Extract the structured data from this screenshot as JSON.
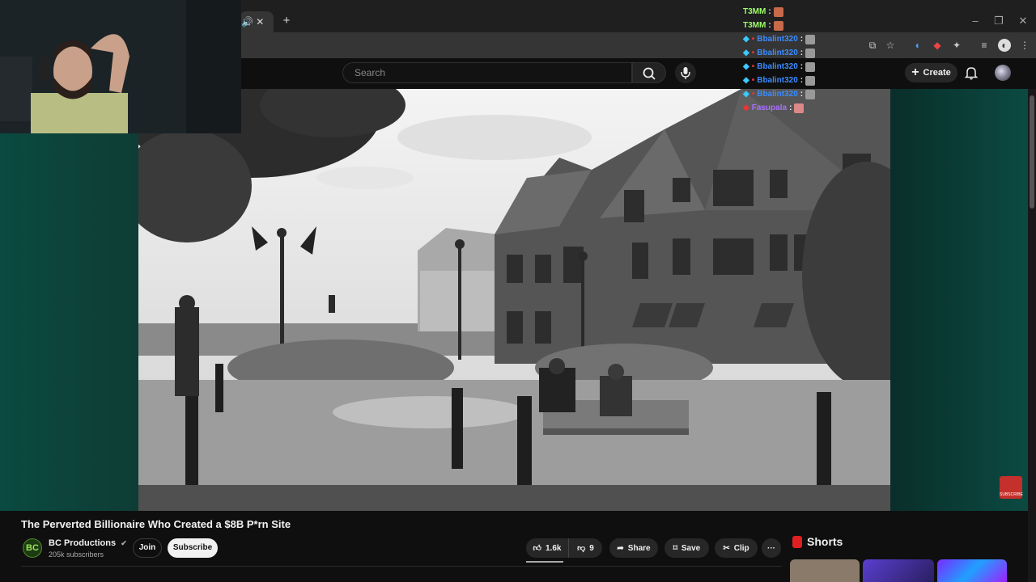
{
  "browser": {
    "tab_icons": "🔊 ✕",
    "new_tab": "+",
    "window_controls": [
      "–",
      "❐",
      "✕"
    ]
  },
  "youtube": {
    "search_placeholder": "Search",
    "create_label": "Create"
  },
  "chat": [
    {
      "user": "T3MM",
      "color": "#9dff6a"
    },
    {
      "user": "T3MM",
      "color": "#9dff6a"
    },
    {
      "user": "Bbalint320",
      "color": "#3b8bff"
    },
    {
      "user": "Bbalint320",
      "color": "#3b8bff"
    },
    {
      "user": "Bbalint320",
      "color": "#3b8bff"
    },
    {
      "user": "Bbalint320",
      "color": "#3b8bff"
    },
    {
      "user": "Bbalint320",
      "color": "#3b8bff"
    },
    {
      "user": "Fasupala",
      "color": "#a970ff"
    }
  ],
  "chat_separator": ":",
  "video": {
    "title": "The Perverted Billionaire Who Created a $8B P*rn Site",
    "subscribe_watermark": "SUBSCRIBE"
  },
  "channel": {
    "logo_text": "BC",
    "name": "BC Productions",
    "verified": "✔",
    "subscribers": "205k subscribers",
    "join_label": "Join",
    "subscribe_label": "Subscribe"
  },
  "actions": {
    "likes": "1.6k",
    "dislikes": "9",
    "share": "Share",
    "save": "Save",
    "clip": "Clip",
    "more": "···"
  },
  "sidebar": {
    "shorts_label": "Shorts"
  },
  "colors": {
    "accent_red": "#ff0000",
    "player_bg": "#0a3a33"
  }
}
